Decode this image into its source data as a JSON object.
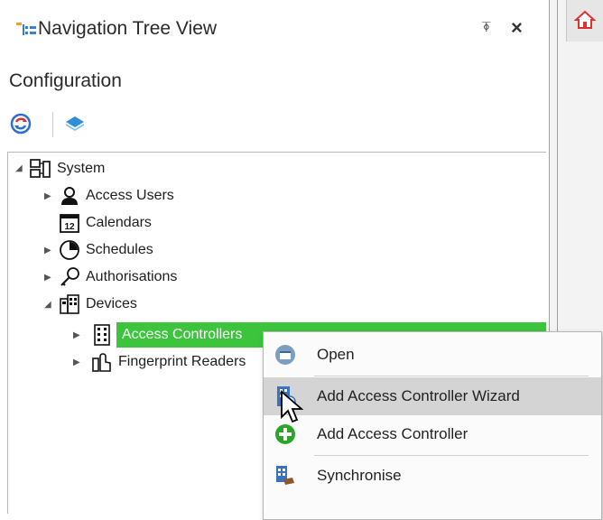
{
  "panel": {
    "title": "Navigation Tree View",
    "pin_glyph": "⍕",
    "close_glyph": "×",
    "section_label": "Configuration"
  },
  "toolbar": {
    "refresh_icon": "refresh-icon",
    "layers_icon": "layers-icon"
  },
  "tree": {
    "root": {
      "label": "System",
      "expanded": true
    },
    "items": [
      {
        "label": "Access Users",
        "expander": "collapsed"
      },
      {
        "label": "Calendars",
        "expander": "none"
      },
      {
        "label": "Schedules",
        "expander": "collapsed"
      },
      {
        "label": "Authorisations",
        "expander": "collapsed"
      },
      {
        "label": "Devices",
        "expander": "expanded"
      },
      {
        "label": "Access Controllers",
        "expander": "collapsed",
        "selected": true
      },
      {
        "label": "Fingerprint Readers",
        "expander": "collapsed"
      }
    ]
  },
  "context_menu": {
    "items": [
      {
        "label": "Open"
      },
      {
        "label": "Add Access Controller Wizard",
        "hovered": true
      },
      {
        "label": "Add Access Controller"
      },
      {
        "label": "Synchronise"
      }
    ]
  },
  "colors": {
    "selection": "#3cc43c",
    "menu_hover": "#d4d4d4",
    "add_green": "#2aa52a"
  }
}
